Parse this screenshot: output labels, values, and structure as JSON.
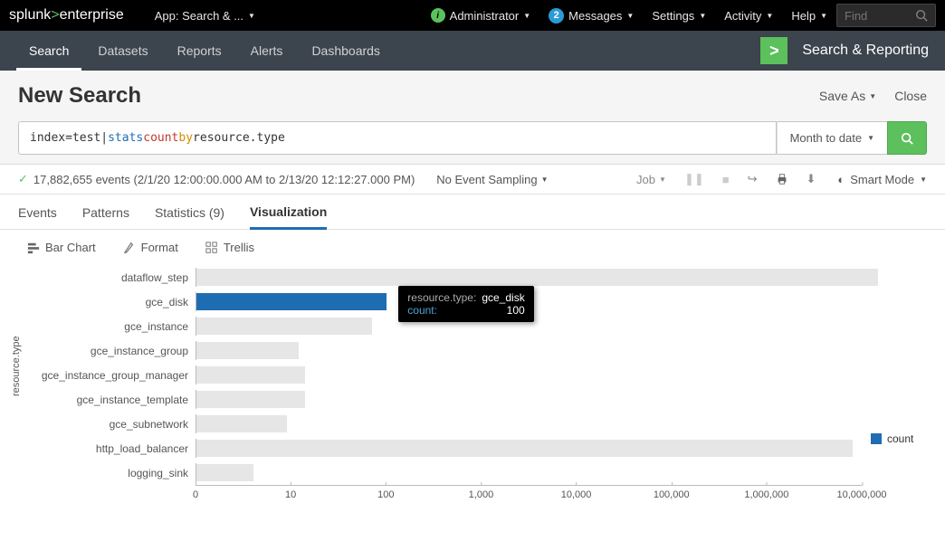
{
  "topnav": {
    "logo_a": "splunk",
    "logo_b": "enterprise",
    "app_label": "App: Search & ...",
    "admin": "Administrator",
    "messages": "Messages",
    "messages_count": "2",
    "settings": "Settings",
    "activity": "Activity",
    "help": "Help",
    "find_placeholder": "Find"
  },
  "secnav": {
    "items": [
      "Search",
      "Datasets",
      "Reports",
      "Alerts",
      "Dashboards"
    ],
    "app_name": "Search & Reporting"
  },
  "page": {
    "title": "New Search",
    "save_as": "Save As",
    "close": "Close"
  },
  "search": {
    "q_index": "index=test",
    "q_pipe": " | ",
    "q_stats": "stats",
    "q_count": " count ",
    "q_by": "by",
    "q_rest": " resource.type",
    "time_label": "Month to date"
  },
  "status": {
    "events": "17,882,655 events (2/1/20 12:00:00.000 AM to 2/13/20 12:12:27.000 PM)",
    "sampling": "No Event Sampling",
    "job": "Job",
    "smart_mode": "Smart Mode"
  },
  "tabs": {
    "events": "Events",
    "patterns": "Patterns",
    "stats": "Statistics (9)",
    "viz": "Visualization"
  },
  "viztoolbar": {
    "bar": "Bar Chart",
    "format": "Format",
    "trellis": "Trellis"
  },
  "legend": {
    "label": "count"
  },
  "tooltip": {
    "k1": "resource.type:",
    "v1": "gce_disk",
    "k2": "count:",
    "v2": "100"
  },
  "ylabel": "resource.type",
  "chart_data": {
    "type": "bar",
    "orientation": "horizontal",
    "xscale": "log",
    "xlabel": "",
    "ylabel": "resource.type",
    "xlim": [
      0,
      10000000
    ],
    "xticks": [
      0,
      10,
      100,
      1000,
      10000,
      100000,
      1000000,
      10000000
    ],
    "xtick_labels": [
      "0",
      "10",
      "100",
      "1,000",
      "10,000",
      "100,000",
      "1,000,000",
      "10,000,000"
    ],
    "categories": [
      "dataflow_step",
      "gce_disk",
      "gce_instance",
      "gce_instance_group",
      "gce_instance_group_manager",
      "gce_instance_template",
      "gce_subnetwork",
      "http_load_balancer",
      "logging_sink"
    ],
    "series": [
      {
        "name": "count",
        "values": [
          15000000,
          100,
          70,
          12,
          14,
          14,
          9,
          8000000,
          4
        ]
      }
    ],
    "highlight_index": 1
  }
}
